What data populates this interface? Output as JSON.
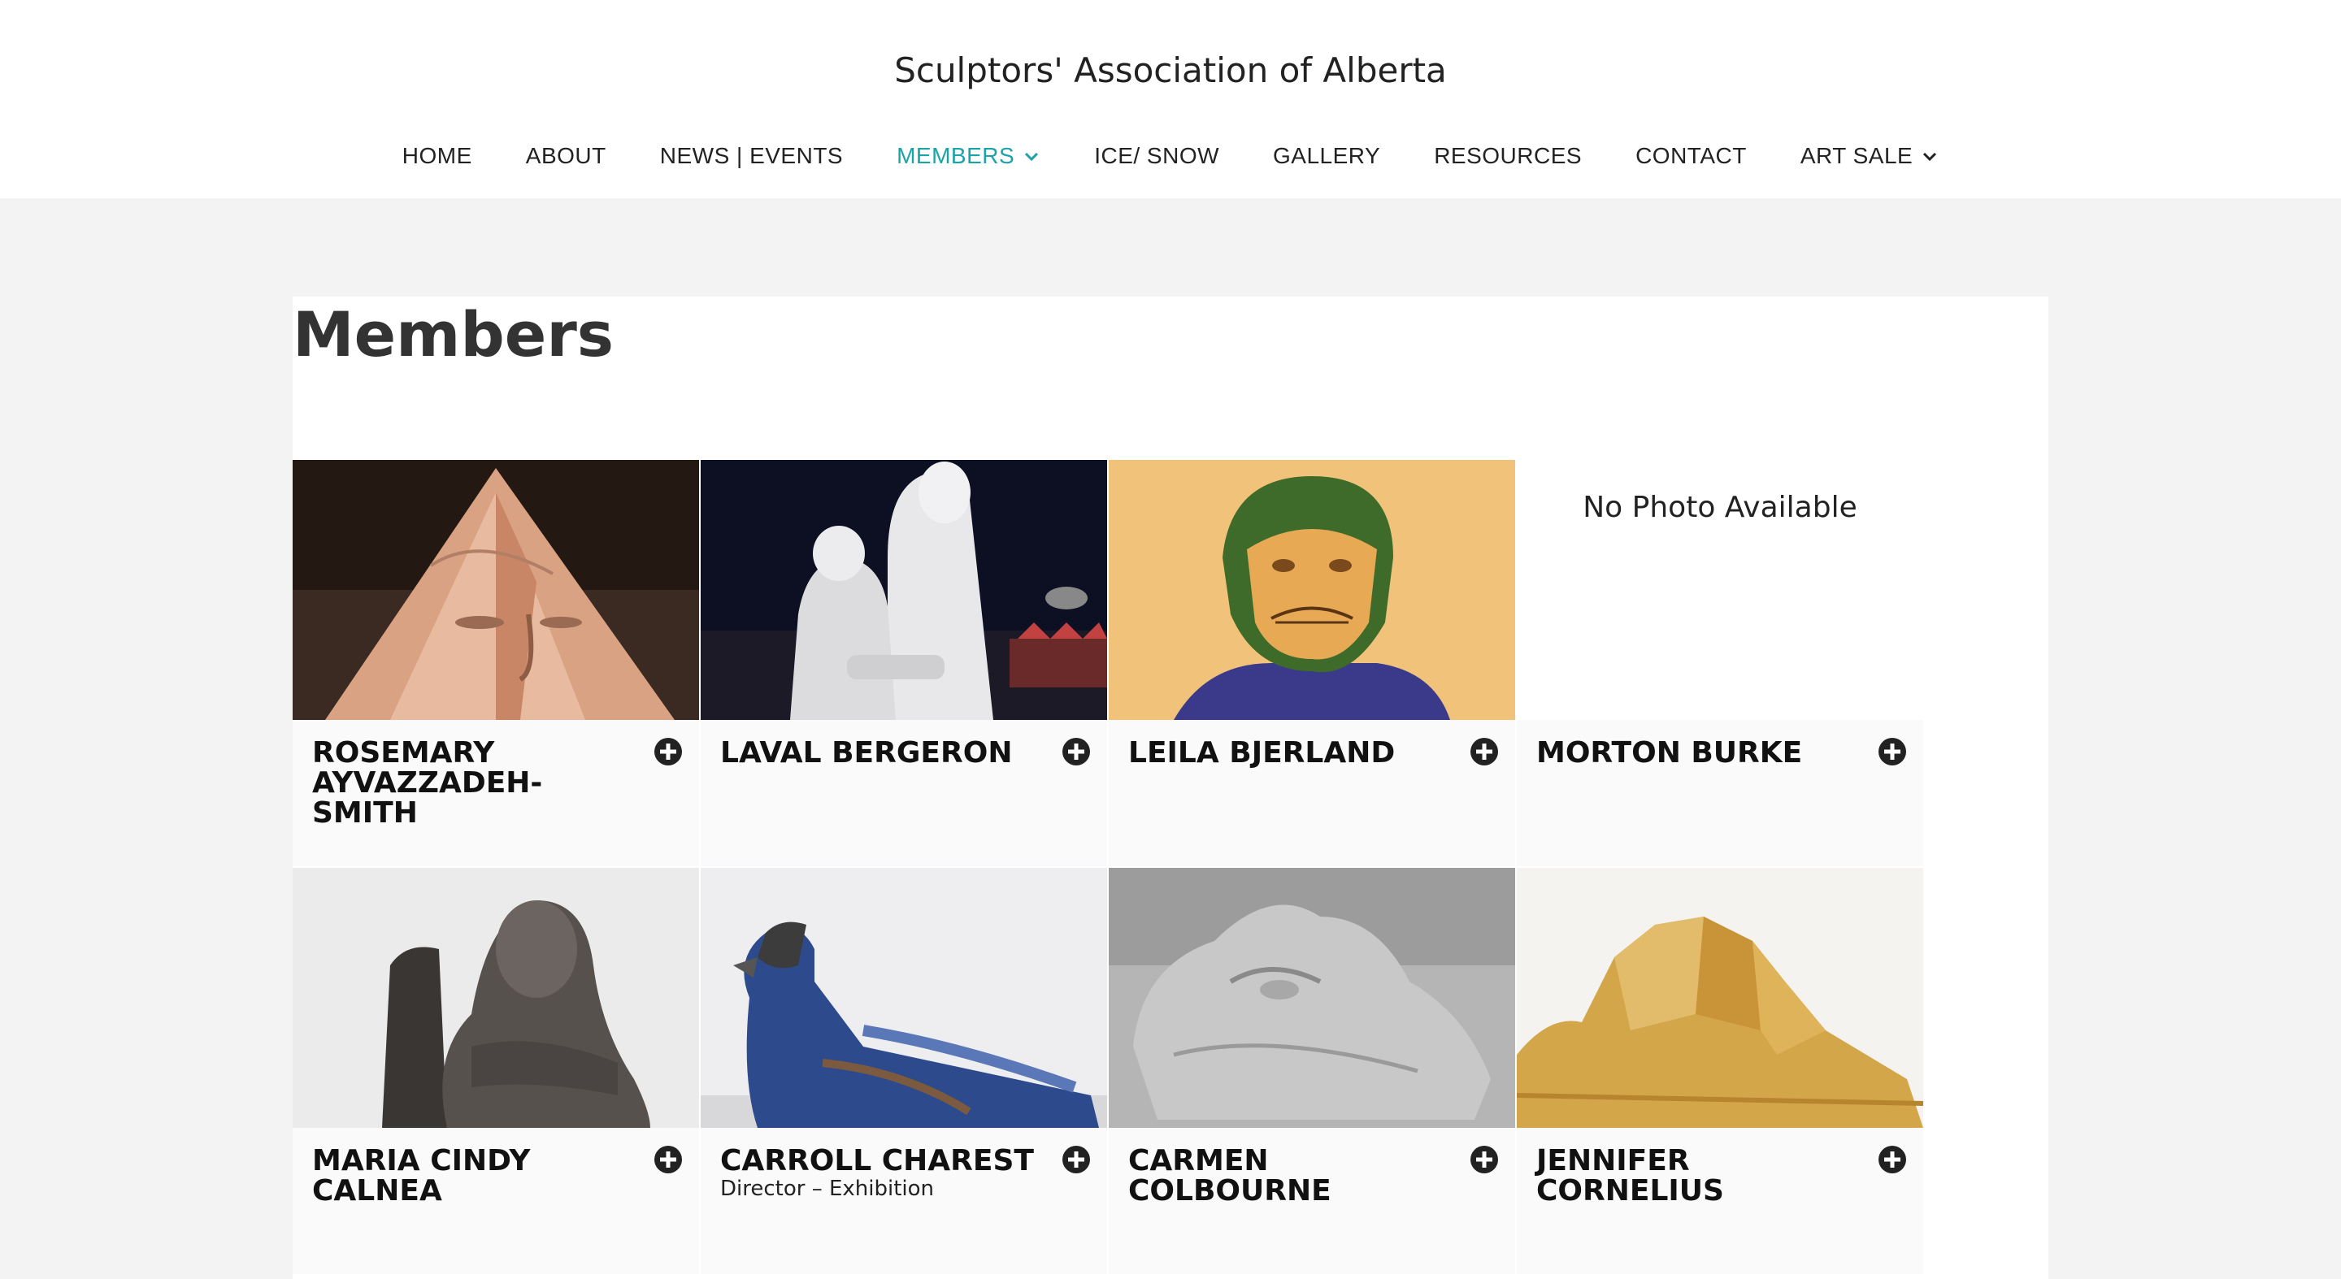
{
  "site": {
    "title": "Sculptors' Association of Alberta"
  },
  "nav": {
    "items": [
      {
        "label": "HOME",
        "active": false,
        "dropdown": false
      },
      {
        "label": "ABOUT",
        "active": false,
        "dropdown": false
      },
      {
        "label": "NEWS | EVENTS",
        "active": false,
        "dropdown": false
      },
      {
        "label": "MEMBERS",
        "active": true,
        "dropdown": true
      },
      {
        "label": "ICE/ SNOW",
        "active": false,
        "dropdown": false
      },
      {
        "label": "GALLERY",
        "active": false,
        "dropdown": false
      },
      {
        "label": "RESOURCES",
        "active": false,
        "dropdown": false
      },
      {
        "label": "CONTACT",
        "active": false,
        "dropdown": false
      },
      {
        "label": "ART SALE",
        "active": false,
        "dropdown": true
      }
    ]
  },
  "page": {
    "title": "Members"
  },
  "members": [
    {
      "name": "ROSEMARY AYVAZZADEH-SMITH",
      "role": "",
      "photo": "stone-face-sculpture"
    },
    {
      "name": "LAVAL BERGERON",
      "role": "",
      "photo": "snow-sculpture-figures"
    },
    {
      "name": "LEILA BJERLAND",
      "role": "",
      "photo": "painted-portrait"
    },
    {
      "name": "MORTON BURKE",
      "role": "",
      "photo": "none",
      "no_photo_text": "No Photo Available"
    },
    {
      "name": "MARIA CINDY CALNEA",
      "role": "",
      "photo": "seated-figure-sculpture"
    },
    {
      "name": "CARROLL CHAREST",
      "role": "Director – Exhibition",
      "photo": "blue-bird-sculpture"
    },
    {
      "name": "CARMEN COLBOURNE",
      "role": "",
      "photo": "grey-stone-carving"
    },
    {
      "name": "JENNIFER CORNELIUS",
      "role": "",
      "photo": "golden-stone-carving"
    }
  ],
  "colors": {
    "accent": "#1aa3a8",
    "header_bg": "#ffffff",
    "page_bg": "#f3f3f3",
    "text": "#111111"
  }
}
